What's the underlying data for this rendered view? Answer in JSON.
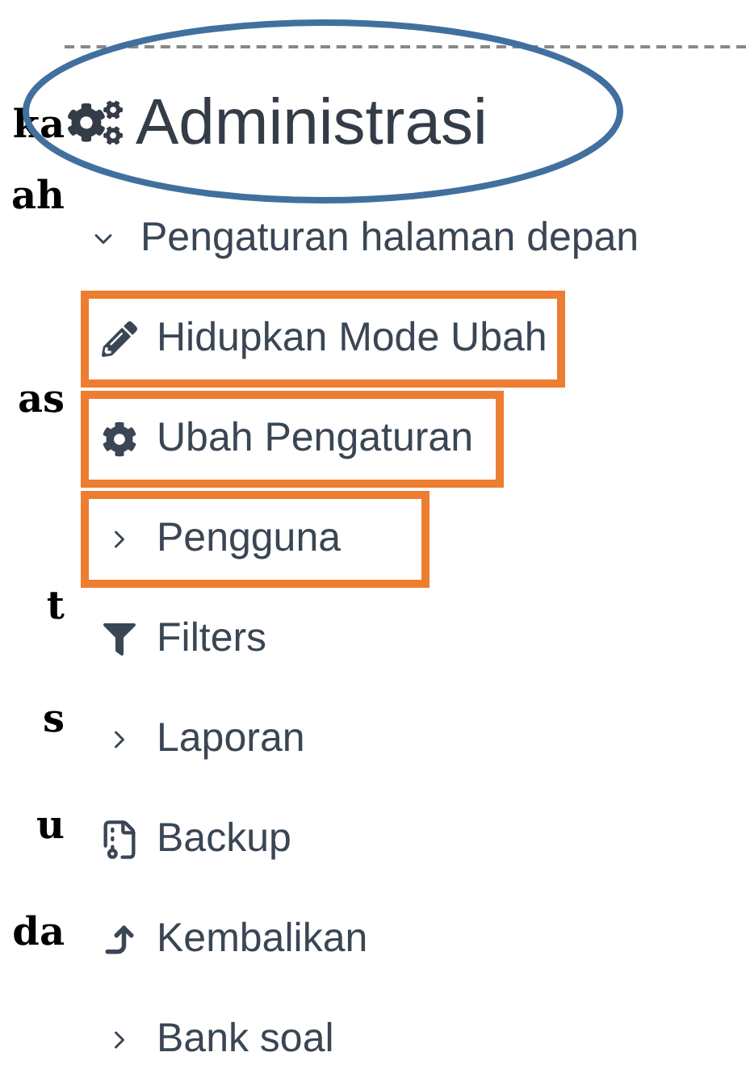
{
  "document_fragments": [
    "ka",
    "ah",
    "as",
    "t",
    "s",
    "u",
    "da"
  ],
  "block": {
    "title": "Administrasi",
    "title_circled": true,
    "items": [
      {
        "kind": "branch",
        "label": "Pengaturan halaman depan",
        "expanded": true,
        "highlighted": false,
        "children": [
          {
            "kind": "pencil",
            "label": "Hidupkan Mode Ubah",
            "highlighted": true
          },
          {
            "kind": "gear",
            "label": "Ubah Pengaturan",
            "highlighted": true
          },
          {
            "kind": "branch",
            "label": "Pengguna",
            "expanded": false,
            "highlighted": true
          },
          {
            "kind": "funnel",
            "label": "Filters",
            "highlighted": false
          },
          {
            "kind": "branch",
            "label": "Laporan",
            "expanded": false,
            "highlighted": false
          },
          {
            "kind": "archive",
            "label": "Backup",
            "highlighted": false
          },
          {
            "kind": "arrow",
            "label": "Kembalikan",
            "highlighted": false
          },
          {
            "kind": "branch",
            "label": "Bank soal",
            "expanded": false,
            "highlighted": false
          }
        ]
      }
    ]
  }
}
